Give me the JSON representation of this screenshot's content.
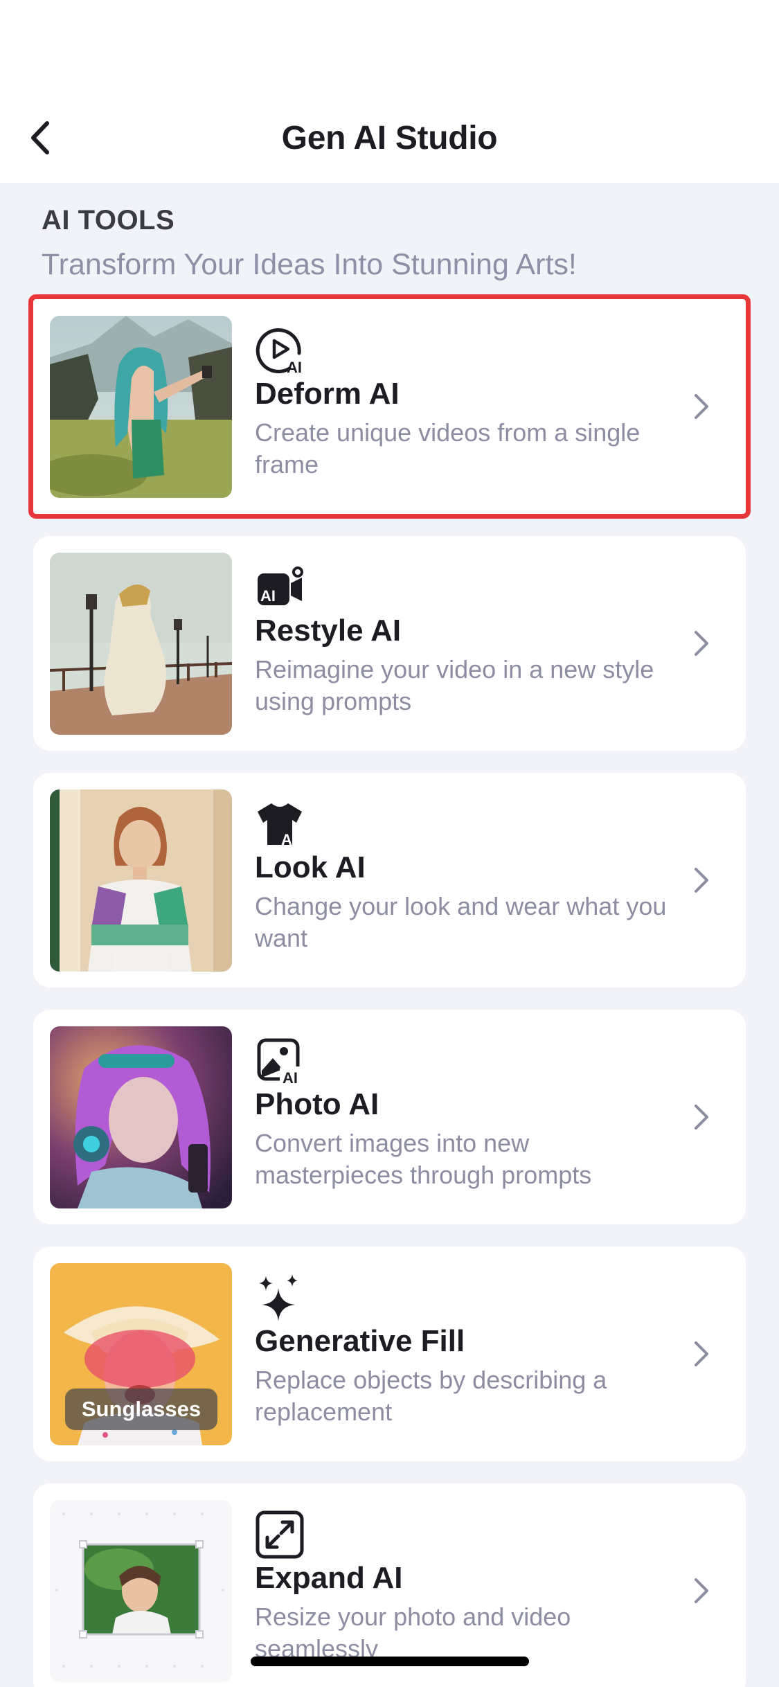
{
  "header": {
    "title": "Gen AI Studio"
  },
  "section": {
    "label": "AI TOOLS",
    "subtitle": "Transform Your Ideas Into Stunning Arts!"
  },
  "tools": [
    {
      "title": "Deform AI",
      "description": "Create unique videos from a single frame",
      "icon": "play-ai-icon"
    },
    {
      "title": "Restyle AI",
      "description": "Reimagine your video in a new style using prompts",
      "icon": "camera-ai-icon"
    },
    {
      "title": "Look AI",
      "description": "Change your look and wear what you want",
      "icon": "shirt-ai-icon"
    },
    {
      "title": "Photo AI",
      "description": "Convert images into new masterpieces through prompts",
      "icon": "image-ai-icon"
    },
    {
      "title": "Generative Fill",
      "description": "Replace objects by describing a replacement",
      "icon": "sparkles-icon",
      "badge": "Sunglasses"
    },
    {
      "title": "Expand AI",
      "description": "Resize your photo and video seamlessly",
      "icon": "expand-icon"
    }
  ],
  "colors": {
    "highlight": "#E8373A",
    "background": "#F2F3F8",
    "card": "#FFFFFF"
  }
}
